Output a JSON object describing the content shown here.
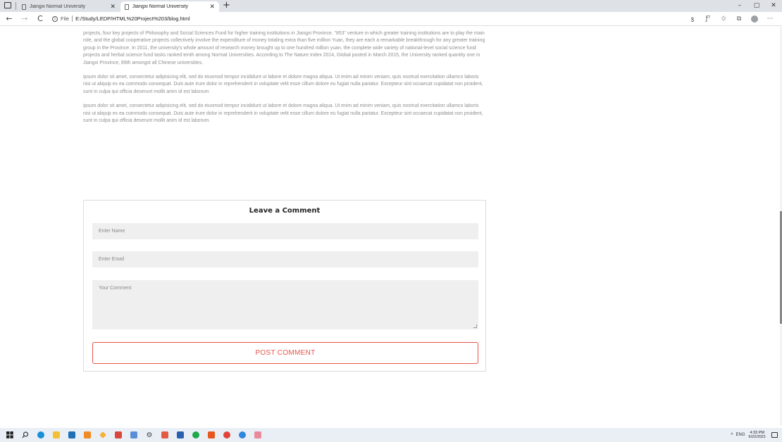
{
  "browser": {
    "tabs": [
      {
        "title": "Jiangxi Normal University",
        "active": false
      },
      {
        "title": "Jiangxi Normal University",
        "active": true
      }
    ],
    "new_tab": "+",
    "window_controls": {
      "minimize": "–",
      "maximize": "▢",
      "close": "✕"
    },
    "nav": {
      "back": "←",
      "forward": "→",
      "refresh": "C"
    },
    "address": {
      "scheme_label": "File",
      "url": "E:/Study/LEDP/HTML%20Project%203/blog.html"
    },
    "toolbar": {
      "read_aloud": "ꝸ",
      "reader": "ƒ⁷",
      "favorites": "✩",
      "collections": "⧉",
      "more": "···"
    }
  },
  "article": {
    "paragraphs": [
      "projects, four key projects of Philosophy and Social Sciences Fund for higher training institutions in Jiangxi Province. \"853\" venture in which greater training institutions are to play the main role, and the global cooperative projects collectively involve the expenditure of money totaling extra than five million Yuan, they are each a remarkable breakthrough for any greater training group in the Province. In 2011, the university's whole amount of research money brought up to one hundred million yuan, the complete wide variety of national-level social science fund projects and herbal science fund tasks ranked tenth among Normal Universities. According to The Nature Index 2014, Global posted in March 2015, the University ranked quantity one in Jiangxi Province, 89th amongst all Chinese universities.",
      "ipsum dolor sit amet, consectetur adipisicing elit, sed do eiusmod tempor incididunt ut labore et dolore magna aliqua. Ut enim ad minim veniam, quis nostrud exercitation ullamco laboris nisi ut aliquip ex ea commodo consequat. Duis aute irure dolor in reprehenderit in voluptate velit esse cillum dolore eu fugiat nulla pariatur. Excepteur sint occaecat cupidatat non proident, sunt in culpa qui officia deserunt mollit anim id est laborum.",
      "ipsum dolor sit amet, consectetur adipisicing elit, sed do eiusmod tempor incididunt ut labore et dolore magna aliqua. Ut enim ad minim veniam, quis nostrud exercitation ullamco laboris nisi ut aliquip ex ea commodo consequat. Duis aute irure dolor in reprehenderit in voluptate velit esse cillum dolore eu fugiat nulla pariatur. Excepteur sint occaecat cupidatat non proident, sunt in culpa qui officia deserunt mollit anim id est laborum."
    ]
  },
  "comment_form": {
    "title": "Leave a Comment",
    "name_placeholder": "Enter Name",
    "email_placeholder": "Enter Email",
    "comment_placeholder": "Your Comment",
    "submit_label": "POST COMMENT",
    "accent_color": "#e8534a"
  },
  "taskbar": {
    "apps": [
      "start-icon",
      "search-icon",
      "edge-icon",
      "file-explorer-icon",
      "store-icon",
      "sublime-icon",
      "pen-icon",
      "paint-icon",
      "sound-icon",
      "settings-icon",
      "calendar-icon",
      "word-icon",
      "app-icon",
      "office-icon",
      "chrome-icon",
      "browser-icon",
      "snip-icon"
    ],
    "tray": {
      "chevron": "^",
      "language": "ENG",
      "time": "4:33 PM",
      "date": "6/22/2021"
    }
  }
}
